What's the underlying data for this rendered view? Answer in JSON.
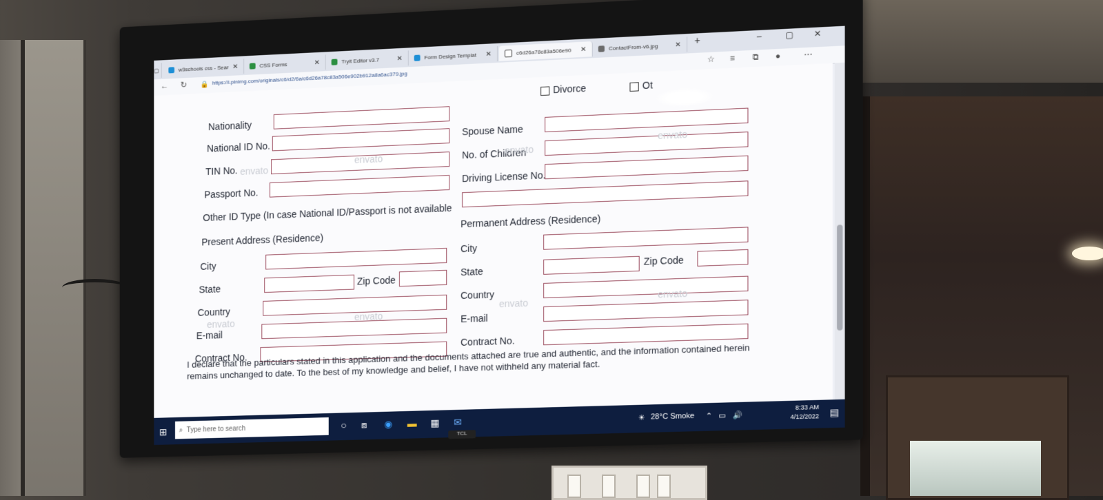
{
  "browser": {
    "tabs": [
      {
        "label": "w3schools css - Searc",
        "icon": "bing-icon",
        "color": "#1d8fd6"
      },
      {
        "label": "CSS Forms",
        "icon": "w3-icon",
        "color": "#2c8f41"
      },
      {
        "label": "Tryit Editor v3.7",
        "icon": "w3-icon",
        "color": "#2c8f41"
      },
      {
        "label": "Form Design Templat",
        "icon": "bing-icon",
        "color": "#1d8fd6"
      },
      {
        "label": "c6d26a78c83a506e90",
        "icon": "page-icon",
        "color": "#444444"
      },
      {
        "label": "ContactFrom-v6.jpg",
        "icon": "image-icon",
        "color": "#6b6b6b"
      }
    ],
    "new_tab": "+",
    "address": "https://i.pinimg.com/originals/c6/d2/6a/c6d26a78c83a506e902b912a8a6ac379.jpg"
  },
  "form": {
    "marital": {
      "divorce": "Divorce",
      "other": "Ot"
    },
    "left": {
      "nationality": "Nationality",
      "national_id": "National ID No.",
      "tin": "TIN No.",
      "passport": "Passport No.",
      "other_id": "Other ID Type (In case National ID/Passport is not available",
      "present_address": "Present Address (Residence)",
      "city": "City",
      "state": "State",
      "zip": "Zip Code",
      "country": "Country",
      "email": "E-mail",
      "contract": "Contract No."
    },
    "right": {
      "spouse": "Spouse Name",
      "children": "No. of Children",
      "driving": "Driving License No.",
      "permanent_address": "Permanent Address (Residence)",
      "city": "City",
      "state": "State",
      "zip": "Zip Code",
      "country": "Country",
      "email": "E-mail",
      "contract": "Contract No."
    },
    "watermark": "envato",
    "declaration": "I declare that the particulars stated in this application and the documents attached are true and authentic,  and  the information contained herein remains unchanged to date. To the best of my knowledge and belief, I have not withheld any material fact."
  },
  "taskbar": {
    "search_placeholder": "Type here to search",
    "weather": "28°C  Smoke",
    "time": "8:33 AM",
    "date": "4/12/2022"
  },
  "tv_brand": "TCL"
}
